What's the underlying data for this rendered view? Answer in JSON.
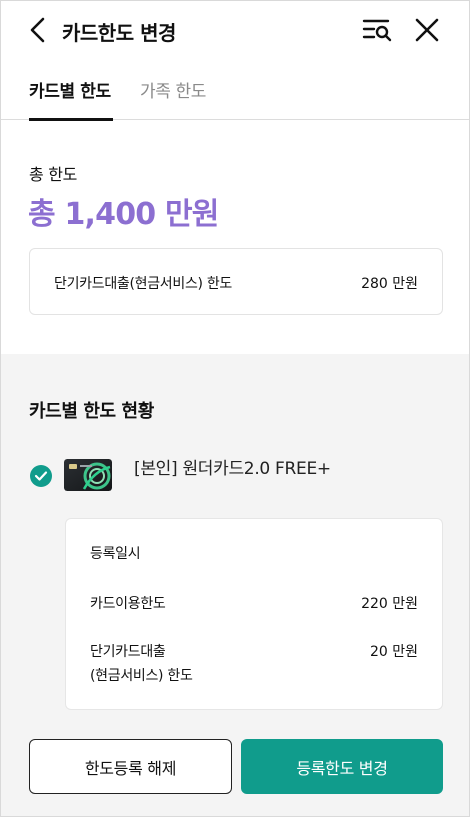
{
  "header": {
    "title": "카드한도 변경",
    "back_icon": "chevron-left-icon",
    "search_icon": "list-search-icon",
    "close_icon": "close-icon"
  },
  "tabs": [
    {
      "label": "카드별 한도",
      "active": true
    },
    {
      "label": "가족 한도",
      "active": false
    }
  ],
  "total": {
    "label": "총 한도",
    "amount": "총 1,400 만원"
  },
  "cash_service": {
    "label": "단기카드대출(현금서비스) 한도",
    "value": "280 만원"
  },
  "card_section": {
    "title": "카드별 한도 현황",
    "card": {
      "name": "[본인] 원더카드2.0 FREE+",
      "selected": true,
      "registration_label": "등록일시",
      "usage_limit_label": "카드이용한도",
      "usage_limit_value": "220 만원",
      "cash_limit_label_line1": "단기카드대출",
      "cash_limit_label_line2": "(현금서비스) 한도",
      "cash_limit_value": "20 만원"
    }
  },
  "buttons": {
    "cancel_registration": "한도등록 해제",
    "change_registration": "등록한도 변경"
  },
  "colors": {
    "accent_purple": "#8c6fd1",
    "primary_teal": "#109c8c",
    "section_gray": "#f4f4f4"
  }
}
